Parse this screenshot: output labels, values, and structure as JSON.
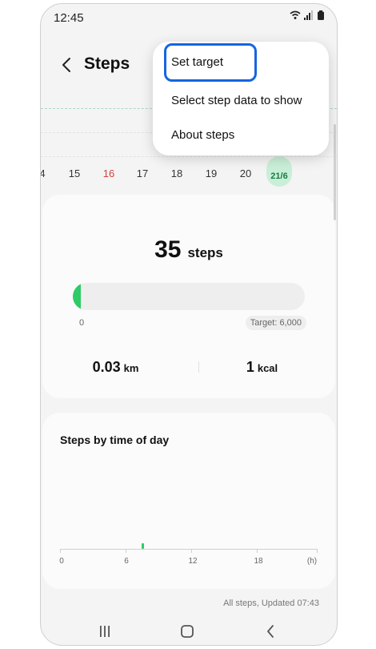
{
  "status_bar": {
    "time": "12:45",
    "icons": [
      "wifi-icon",
      "signal-icon",
      "battery-icon"
    ]
  },
  "header": {
    "title": "Steps",
    "back_icon": "chevron-left-icon"
  },
  "calendar": {
    "days": [
      "4",
      "15",
      "16",
      "17",
      "18",
      "19",
      "20"
    ],
    "selected_day": "21/6",
    "sunday_color": "#d0433b"
  },
  "summary": {
    "count": "35",
    "count_unit": "steps",
    "progress_fraction": 0.006,
    "progress_start": "0",
    "target_label": "Target: 6,000",
    "distance_value": "0.03",
    "distance_unit": "km",
    "calories_value": "1",
    "calories_unit": "kcal",
    "accent_color": "#2fcb66"
  },
  "time_of_day": {
    "title": "Steps by time of day",
    "axis_labels": [
      "0",
      "6",
      "12",
      "18",
      "(h)"
    ]
  },
  "footer": {
    "updated": "All steps, Updated 07:43"
  },
  "menu": {
    "items": [
      "Set target",
      "Select step data to show",
      "About steps"
    ],
    "highlight_color": "#1565e0"
  },
  "navbar": {
    "recents_icon": "recents-icon",
    "home_icon": "home-icon",
    "back_icon": "back-icon"
  }
}
